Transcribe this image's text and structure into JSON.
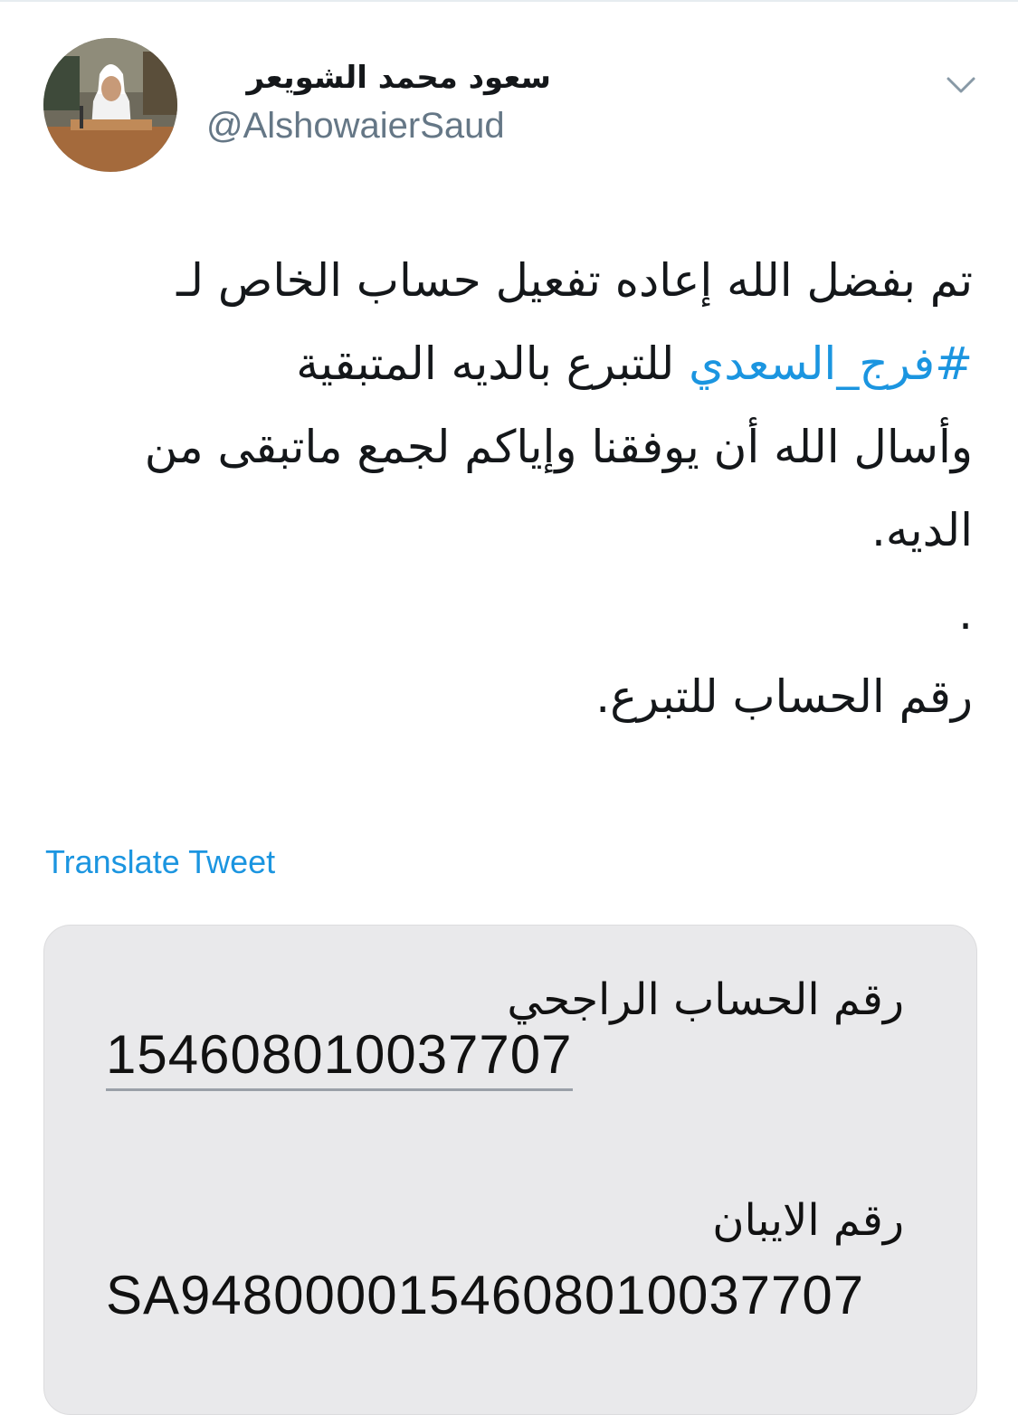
{
  "author": {
    "name": "سعود محمد الشويعر",
    "handle": "@AlshowaierSaud"
  },
  "icons": {
    "avatar": "avatar-photo",
    "menu": "chevron-down-icon"
  },
  "tweet": {
    "line1": "تم بفضل الله إعاده تفعيل حساب الخاص لـ",
    "hashtag": "#فرج_السعدي",
    "line2_rest": " للتبرع بالديه المتبقية",
    "line3": "وأسال الله أن يوفقنا وإياكم لجمع ماتبقى من",
    "line4": "الديه.",
    "line5": ".",
    "line6": "رقم الحساب للتبرع."
  },
  "translate_label": "Translate Tweet",
  "media": {
    "account_label": "رقم الحساب الراجحي",
    "account_number": "154608010037707",
    "iban_label": "رقم الايبان",
    "iban_number": "SA9480000154608010037707"
  },
  "colors": {
    "link": "#1b95e0",
    "secondary_text": "#657786",
    "media_background": "#e9e9eb"
  }
}
